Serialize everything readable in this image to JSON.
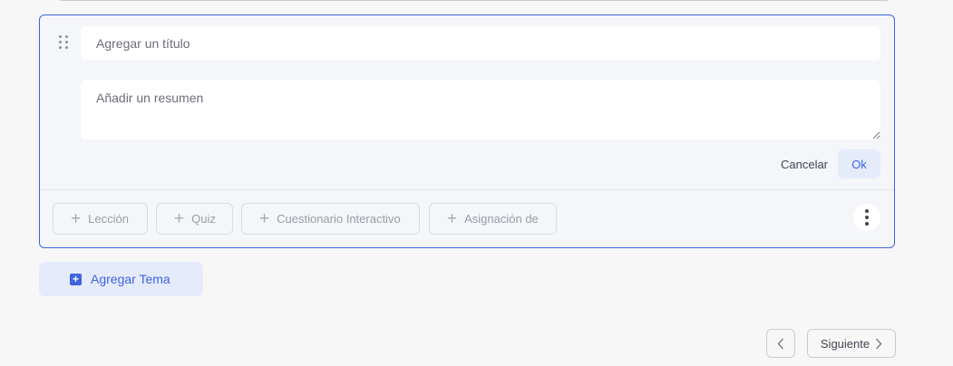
{
  "topic": {
    "title_placeholder": "Agregar un título",
    "summary_placeholder": "Añadir un resumen",
    "cancel_label": "Cancelar",
    "ok_label": "Ok"
  },
  "content_buttons": [
    {
      "label": "Lección",
      "icon": "plus-icon"
    },
    {
      "label": "Quiz",
      "icon": "plus-icon"
    },
    {
      "label": "Cuestionario Interactivo",
      "icon": "plus-icon"
    },
    {
      "label": "Asignación de",
      "icon": "plus-icon"
    }
  ],
  "add_topic_label": "Agregar Tema",
  "pagination": {
    "next_label": "Siguiente"
  },
  "colors": {
    "accent": "#3e64de",
    "accent_light": "#e5ebfb",
    "background": "#f7f7f8",
    "card_background": "#f5f6fa"
  }
}
